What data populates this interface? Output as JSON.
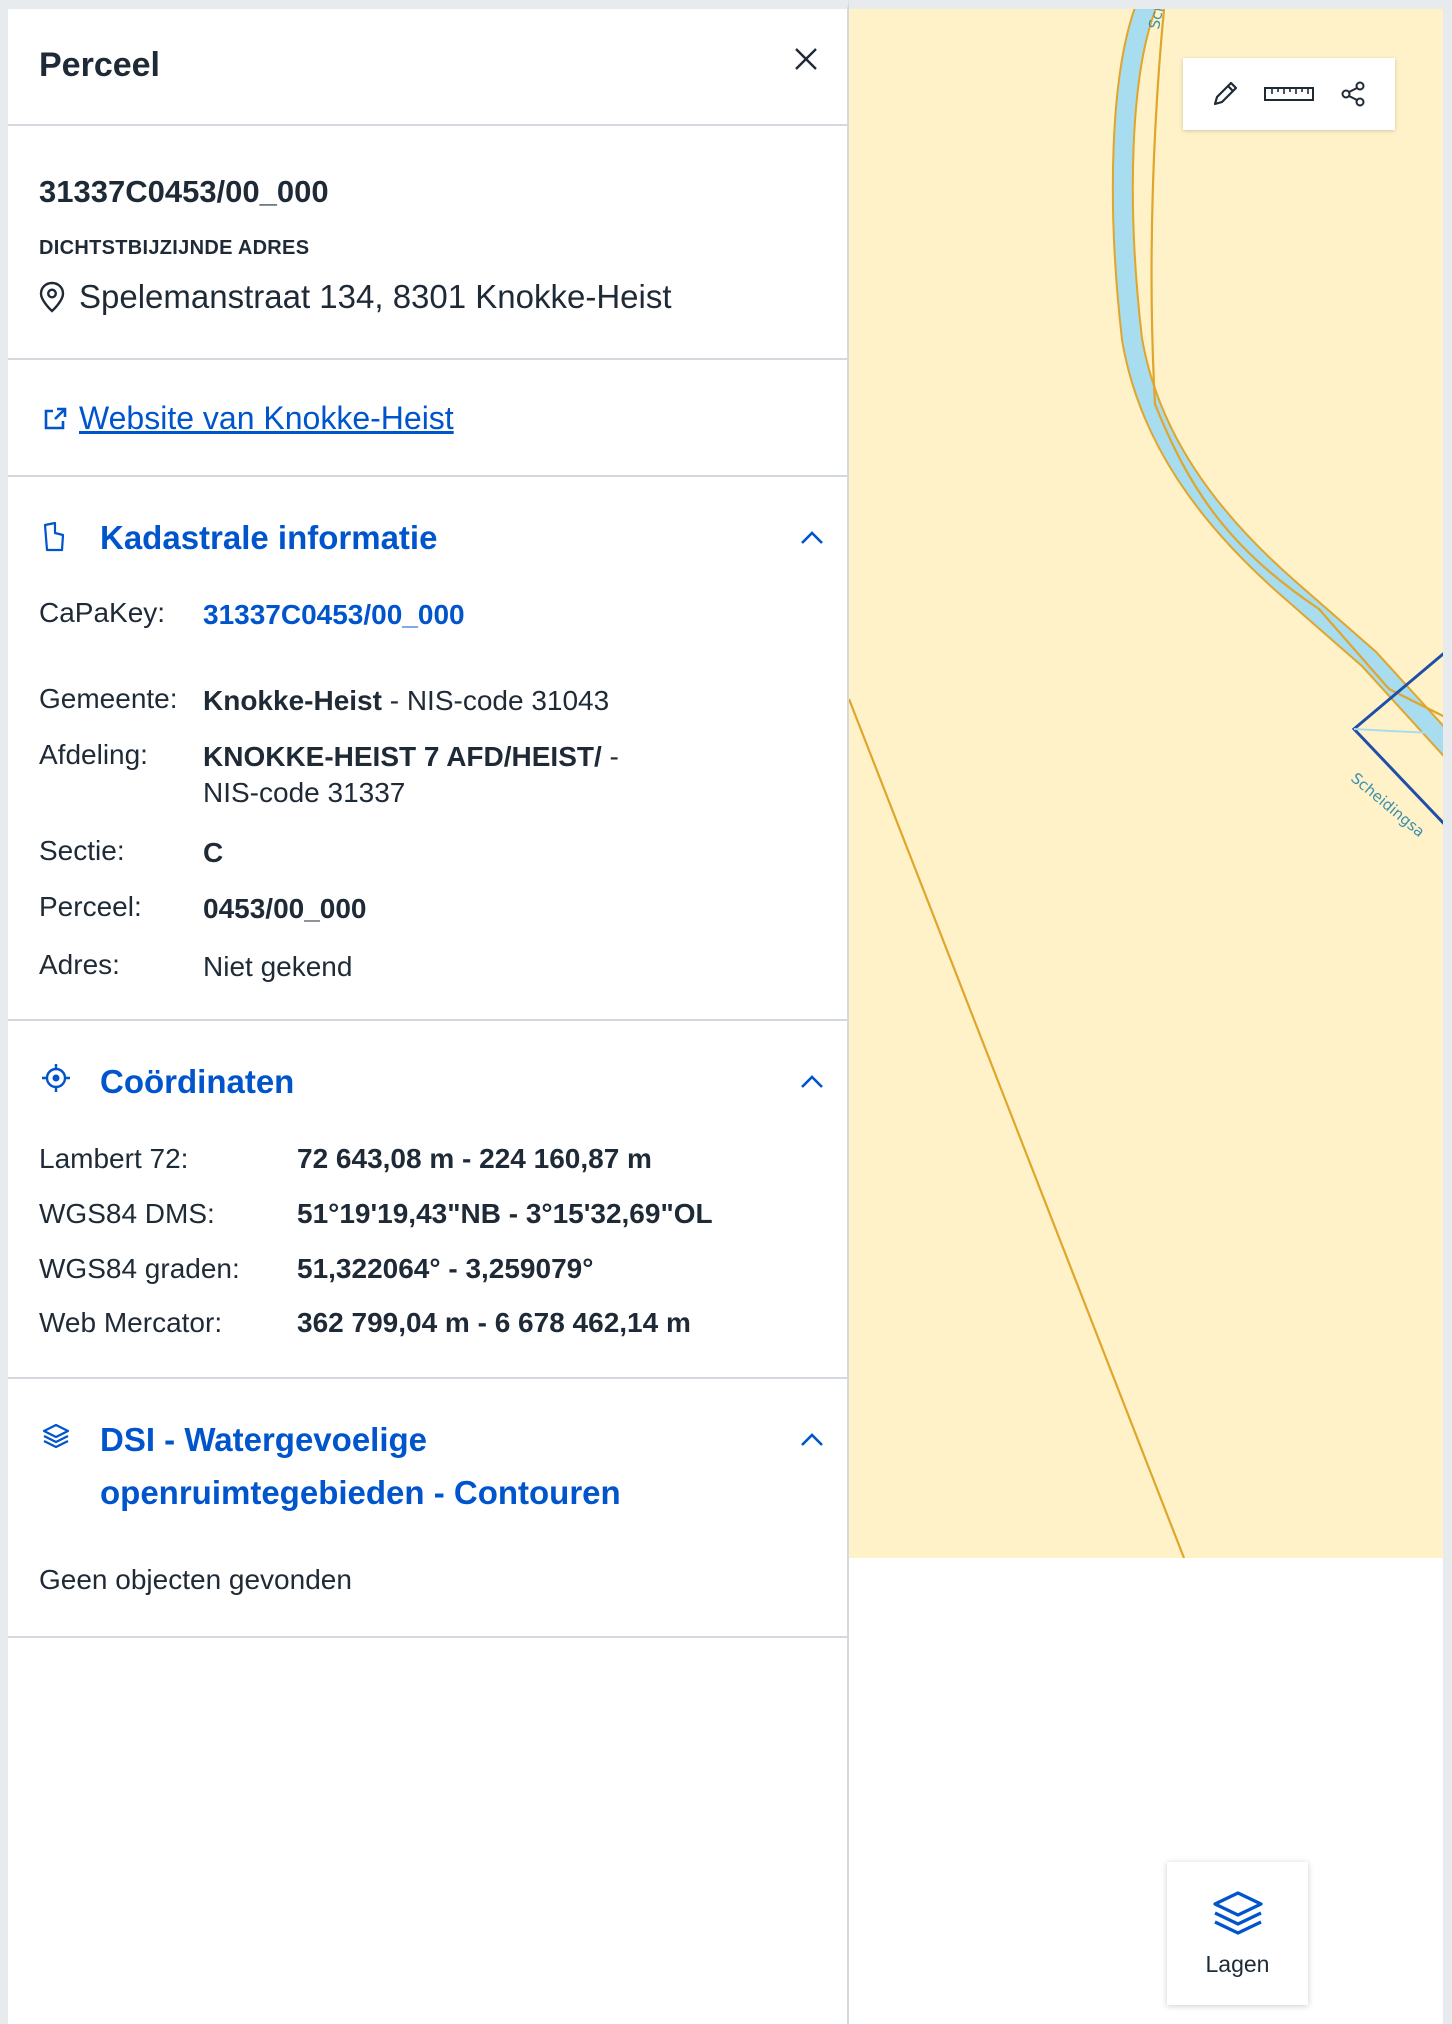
{
  "panel": {
    "title": "Perceel",
    "close_icon": "close-icon",
    "parcel_id": "31337C0453/00_000",
    "address_caption": "DICHTSTBIJZIJNDE ADRES",
    "address": "Spelemanstraat 134, 8301 Knokke-Heist",
    "website_link": "Website van Knokke-Heist"
  },
  "kadaster": {
    "title": "Kadastrale informatie",
    "capakey_label": "CaPaKey:",
    "capakey_value": "31337C0453/00_000",
    "gemeente_label": "Gemeente:",
    "gemeente_name": "Knokke-Heist",
    "gemeente_nis": " - NIS-code 31043",
    "afdeling_label": "Afdeling:",
    "afdeling_name": "KNOKKE-HEIST 7 AFD/HEIST/",
    "afdeling_nis_dash": " -",
    "afdeling_nis": "NIS-code 31337",
    "sectie_label": "Sectie:",
    "sectie_value": "C",
    "perceel_label": "Perceel:",
    "perceel_value": "0453/00_000",
    "adres_label": "Adres:",
    "adres_value": "Niet gekend"
  },
  "coordinates": {
    "title": "Coördinaten",
    "rows": [
      {
        "label": "Lambert 72:",
        "value": "72 643,08 m - 224 160,87 m"
      },
      {
        "label": "WGS84 DMS:",
        "value": "51°19'19,43\"NB - 3°15'32,69\"OL"
      },
      {
        "label": "WGS84 graden:",
        "value": "51,322064° - 3,259079°"
      },
      {
        "label": "Web Mercator:",
        "value": "362 799,04 m - 6 678 462,14 m"
      }
    ]
  },
  "dsi": {
    "title_line1": "DSI - Watergevoelige",
    "title_line2": "openruimtegebieden - Contouren",
    "empty": "Geen objecten gevonden"
  },
  "map": {
    "label_top": "Sche",
    "label_right": "Scheidingsa",
    "toolbar": [
      "pencil-icon",
      "ruler-icon",
      "share-icon"
    ],
    "layers_label": "Lagen",
    "colors": {
      "land": "#fff2c8",
      "water": "#a8dcef",
      "parcel_line": "#e0a52b",
      "selection": "#1f4fa8"
    }
  }
}
